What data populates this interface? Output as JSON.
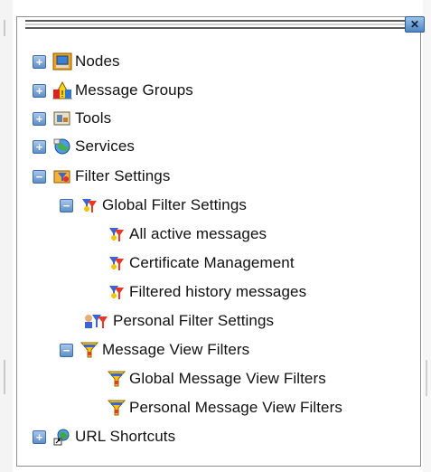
{
  "window": {
    "close_glyph": "✕"
  },
  "tree": {
    "nodes": {
      "label": "Nodes",
      "icon": "nodes-icon",
      "expander": "+"
    },
    "message_groups": {
      "label": "Message Groups",
      "icon": "message-groups-icon",
      "expander": "+"
    },
    "tools": {
      "label": "Tools",
      "icon": "tools-icon",
      "expander": "+"
    },
    "services": {
      "label": "Services",
      "icon": "services-icon",
      "expander": "+"
    },
    "filter_settings": {
      "label": "Filter Settings",
      "icon": "filter-settings-icon",
      "expander": "−",
      "global_filter_settings": {
        "label": "Global Filter Settings",
        "icon": "filter-icon",
        "expander": "−",
        "children": [
          "All active messages",
          "Certificate Management",
          "Filtered history messages"
        ]
      },
      "personal_filter_settings": {
        "label": "Personal Filter Settings",
        "icon": "filter-multi-icon"
      },
      "message_view_filters": {
        "label": "Message View Filters",
        "icon": "funnel-icon",
        "expander": "−",
        "children": [
          "Global Message View Filters",
          "Personal Message View Filters"
        ]
      }
    },
    "url_shortcuts": {
      "label": "URL Shortcuts",
      "icon": "url-shortcuts-icon",
      "expander": "+"
    }
  },
  "colors": {
    "expander_fill": "#5f8fc9",
    "panel_border": "#8f8f8f",
    "text": "#111111"
  }
}
